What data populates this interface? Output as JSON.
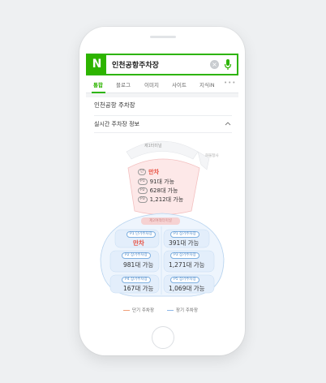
{
  "search": {
    "logo": "N",
    "query": "인천공항주차장",
    "clear": "×"
  },
  "tabs": [
    {
      "label": "통합",
      "active": true
    },
    {
      "label": "블로그",
      "active": false
    },
    {
      "label": "이미지",
      "active": false
    },
    {
      "label": "사이트",
      "active": false
    },
    {
      "label": "지식iN",
      "active": false
    }
  ],
  "more": "•••",
  "section": {
    "title": "인천공항 주차장",
    "realtime": "실시간 주차장 정보"
  },
  "terminal1": {
    "name": "제1터미널",
    "side": "화물청사",
    "rows": [
      {
        "tag": "단",
        "value": "만차",
        "full": true
      },
      {
        "tag": "P1",
        "value": "91대 가능",
        "full": false
      },
      {
        "tag": "P2",
        "value": "628대 가능",
        "full": false
      },
      {
        "tag": "P3",
        "value": "1,212대 가능",
        "full": false
      }
    ]
  },
  "terminal2": {
    "label": "제2여객터미널",
    "cells": [
      {
        "tag": "P1 단기주차장",
        "value": "만차",
        "full": true
      },
      {
        "tag": "P1 장기주차장",
        "value": "391대 가능",
        "full": false
      },
      {
        "tag": "P2 장기주차장",
        "value": "981대 가능",
        "full": false
      },
      {
        "tag": "P3 장기주차장",
        "value": "1,271대 가능",
        "full": false
      },
      {
        "tag": "P4 장기주차장",
        "value": "167대 가능",
        "full": false
      },
      {
        "tag": "P5 장기주차장",
        "value": "1,069대 가능",
        "full": false
      }
    ]
  },
  "legend": {
    "short": "단기 주차장",
    "long": "장기 주차장",
    "short_color": "#f0a07a",
    "long_color": "#8fb8e8"
  },
  "colors": {
    "brand": "#2db400",
    "full": "#e74c3c"
  }
}
